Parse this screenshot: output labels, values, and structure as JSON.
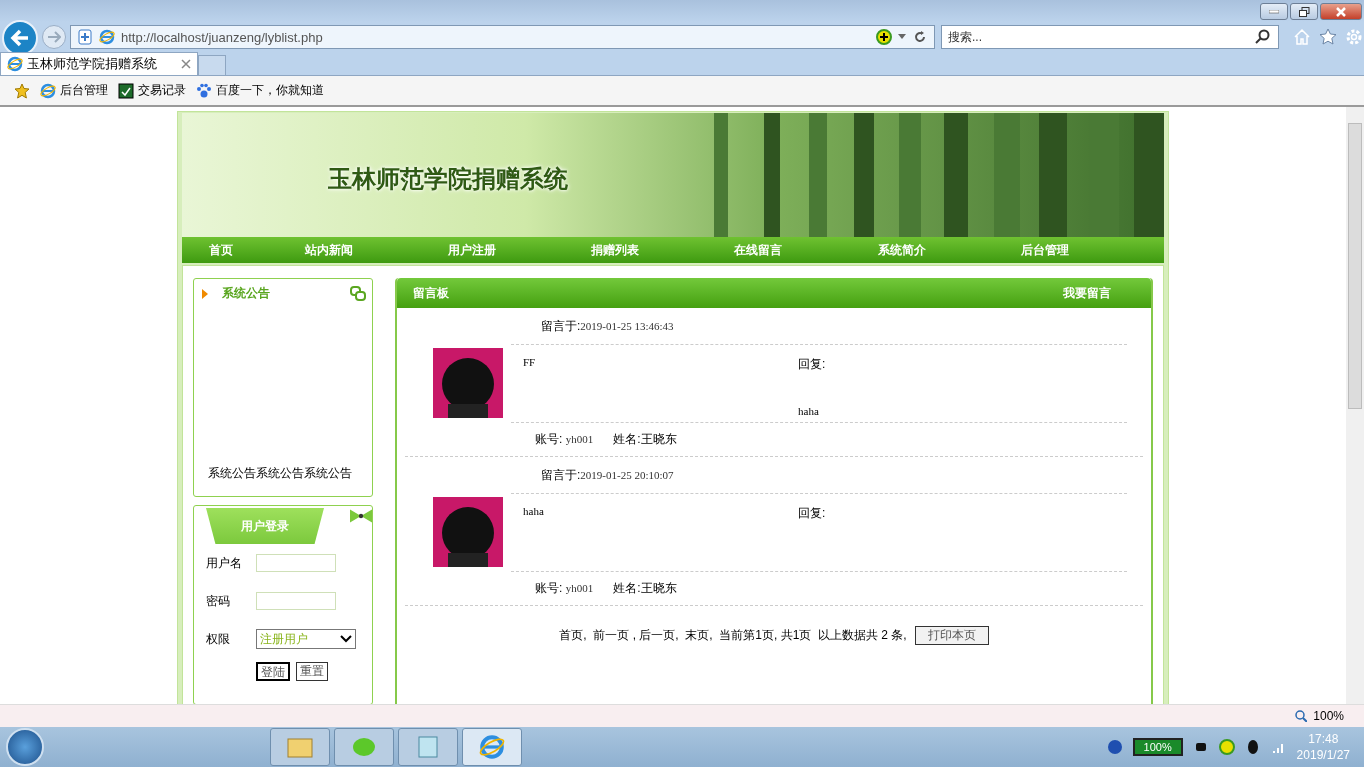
{
  "browser": {
    "address": "http://localhost/juanzeng/lyblist.php",
    "search": {
      "placeholder": "搜索..."
    },
    "tabs": [
      {
        "title": "玉林师范学院捐赠系统",
        "selected": true
      }
    ],
    "favorites": [
      {
        "label": "后台管理",
        "kind": "page"
      },
      {
        "label": "交易记录",
        "kind": "app"
      },
      {
        "label": "百度一下，你就知道",
        "kind": "paw"
      }
    ],
    "zoom": "100%"
  },
  "site": {
    "title": "玉林师范学院捐赠系统",
    "nav": [
      "首页",
      "站内新闻",
      "用户注册",
      "捐赠列表",
      "在线留言",
      "系统简介",
      "后台管理"
    ],
    "notice": {
      "title": "系统公告",
      "text": "系统公告系统公告系统公告"
    },
    "login": {
      "title": "用户登录",
      "fields": [
        {
          "label": "用户名",
          "kind": "text"
        },
        {
          "label": "密码",
          "kind": "password"
        },
        {
          "label": "权限",
          "kind": "select",
          "value": "注册用户"
        }
      ],
      "buttons": [
        {
          "label": "登陆",
          "focused": true
        },
        {
          "label": "重置",
          "focused": false
        }
      ]
    },
    "board": {
      "title": "留言板",
      "action": "我要留言",
      "messages": [
        {
          "time_label": "留言于:",
          "time": "2019-01-25 13:46:43",
          "content": "FF",
          "reply_label": "回复:",
          "reply": "haha",
          "account_label": "账号:",
          "account": "yh001",
          "name_label": "姓名:",
          "name": "王晓东"
        },
        {
          "time_label": "留言于:",
          "time": "2019-01-25 20:10:07",
          "content": "haha",
          "reply_label": "回复:",
          "account_label": "账号:",
          "account": "yh001",
          "name_label": "姓名:",
          "name": "王晓东"
        }
      ],
      "pager": "首页,  前一页 , 后一页,  末页,  当前第1页, 共1页  以上数据共 2 条,",
      "print_button": "打印本页"
    }
  },
  "taskbar": {
    "battery": "100%",
    "time": "17:48",
    "date": "2019/1/27"
  }
}
